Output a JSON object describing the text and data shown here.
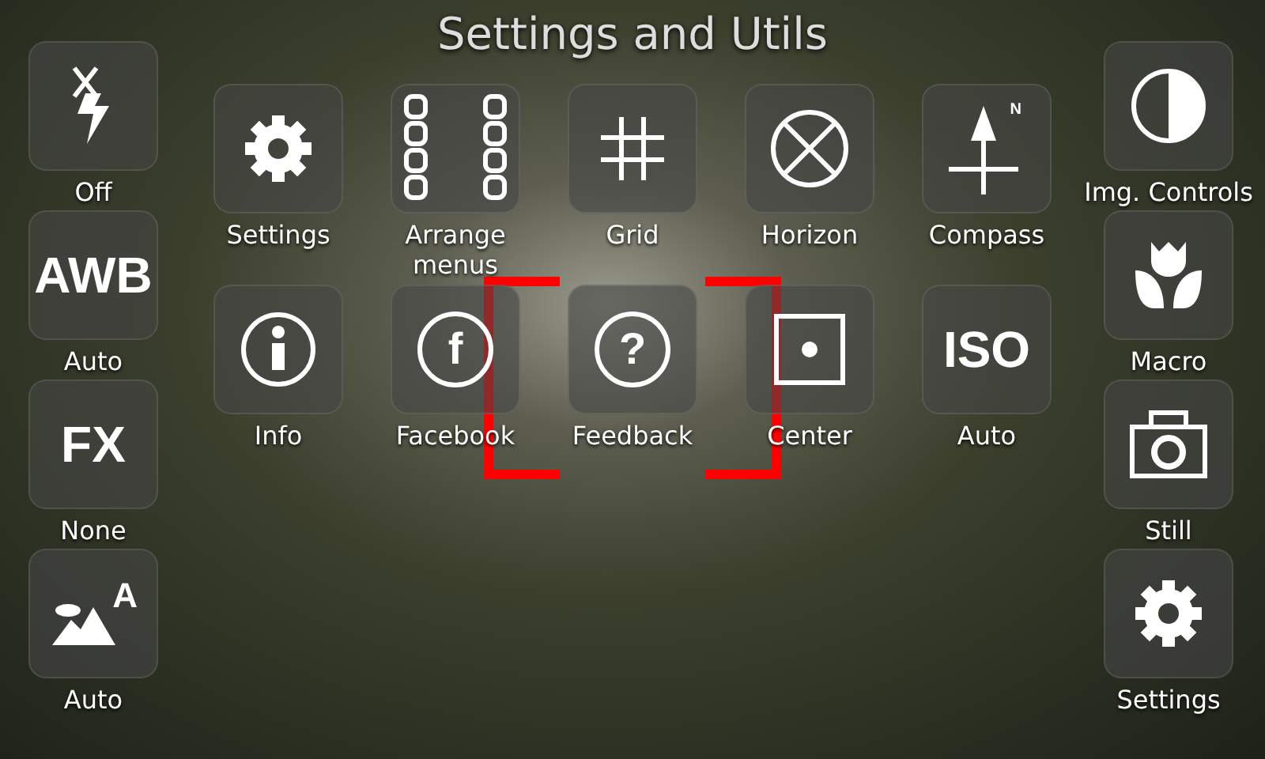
{
  "title": "Settings and Utils",
  "left_controls": [
    {
      "kind": "flash",
      "label": "Off"
    },
    {
      "kind": "text",
      "glyph": "AWB",
      "label": "Auto"
    },
    {
      "kind": "text",
      "glyph": "FX",
      "label": "None"
    },
    {
      "kind": "scene",
      "glyph": "A",
      "label": "Auto"
    }
  ],
  "menu_rows": [
    [
      {
        "kind": "gear",
        "label": "Settings"
      },
      {
        "kind": "arrange",
        "label": "Arrange menus"
      },
      {
        "kind": "grid",
        "label": "Grid"
      },
      {
        "kind": "horizon",
        "label": "Horizon"
      },
      {
        "kind": "compass",
        "glyph": "N",
        "label": "Compass"
      }
    ],
    [
      {
        "kind": "info",
        "label": "Info"
      },
      {
        "kind": "ring",
        "glyph": "f",
        "label": "Facebook"
      },
      {
        "kind": "ring",
        "glyph": "?",
        "label": "Feedback"
      },
      {
        "kind": "center",
        "label": "Center"
      },
      {
        "kind": "text",
        "glyph": "ISO",
        "label": "Auto"
      }
    ]
  ],
  "right_controls": [
    {
      "kind": "contrast",
      "label": "Img. Controls"
    },
    {
      "kind": "macro",
      "label": "Macro"
    },
    {
      "kind": "camera",
      "label": "Still"
    },
    {
      "kind": "gear",
      "label": "Settings"
    }
  ]
}
